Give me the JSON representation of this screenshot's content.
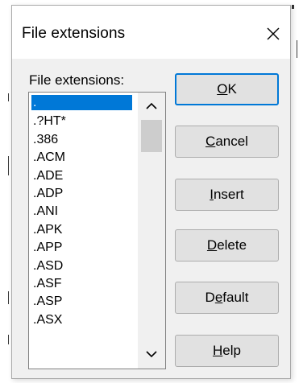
{
  "window": {
    "title": "File extensions",
    "close_glyph": "close-icon"
  },
  "list": {
    "label": "File extensions:",
    "items": [
      ".",
      ".?HT*",
      ".386",
      ".ACM",
      ".ADE",
      ".ADP",
      ".ANI",
      ".APK",
      ".APP",
      ".ASD",
      ".ASF",
      ".ASP",
      ".ASX"
    ],
    "selected_index": 0
  },
  "buttons": {
    "ok": {
      "mnemonic": "O",
      "rest": "K"
    },
    "cancel": {
      "mnemonic": "C",
      "rest": "ancel"
    },
    "insert": {
      "mnemonic": "I",
      "rest": "nsert"
    },
    "delete": {
      "mnemonic": "D",
      "rest": "elete"
    },
    "default": {
      "pre": "D",
      "mnemonic": "e",
      "rest": "fault"
    },
    "help": {
      "mnemonic": "H",
      "rest": "elp"
    }
  },
  "colors": {
    "selection": "#0078d7",
    "dialog_bg": "#f0f0f0",
    "button_bg": "#e1e1e1"
  }
}
